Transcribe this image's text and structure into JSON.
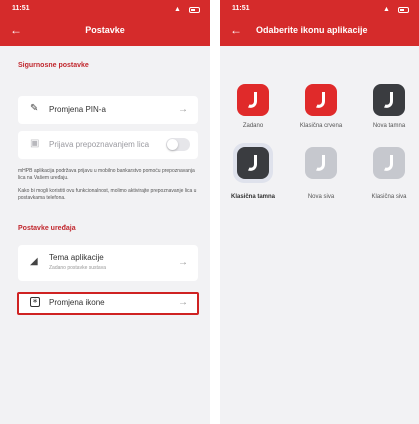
{
  "colors": {
    "brand_red": "#d52b2b",
    "highlight_red": "#cf2222",
    "background": "#f2f2f4"
  },
  "left_screen": {
    "status_time": "11:51",
    "back_icon": "arrow-left-icon",
    "title": "Postavke",
    "security_section_title": "Sigurnosne postavke",
    "pin_change_label": "Promjena PIN-a",
    "face_login_label": "Prijava prepoznavanjem lica",
    "face_login_enabled": false,
    "info_text_1": "mHPB aplikacija podržava prijavu u mobilno bankarstvo pomoću prepoznavanja lica na Vašem uređaju.",
    "info_text_2": "Kako bi mogli koristiti ovu funkcionalnost, molimo aktivirajte prepoznavanje lica u postavkama telefona.",
    "device_section_title": "Postavke uređaja",
    "theme_label": "Tema aplikacije",
    "theme_sublabel": "Zadano postavke sustava",
    "icon_change_label": "Promjena ikone"
  },
  "right_screen": {
    "status_time": "11:51",
    "back_icon": "arrow-left-icon",
    "title": "Odaberite ikonu aplikacije",
    "icons": [
      {
        "label": "Zadano",
        "style": "red",
        "selected": false
      },
      {
        "label": "Klasična crvena",
        "style": "red",
        "selected": false
      },
      {
        "label": "Nova tamna",
        "style": "dark",
        "selected": false
      },
      {
        "label": "Klasična tamna",
        "style": "dark",
        "selected": true
      },
      {
        "label": "Nova siva",
        "style": "gray",
        "selected": false
      },
      {
        "label": "Klasična siva",
        "style": "gray",
        "selected": false
      }
    ]
  }
}
